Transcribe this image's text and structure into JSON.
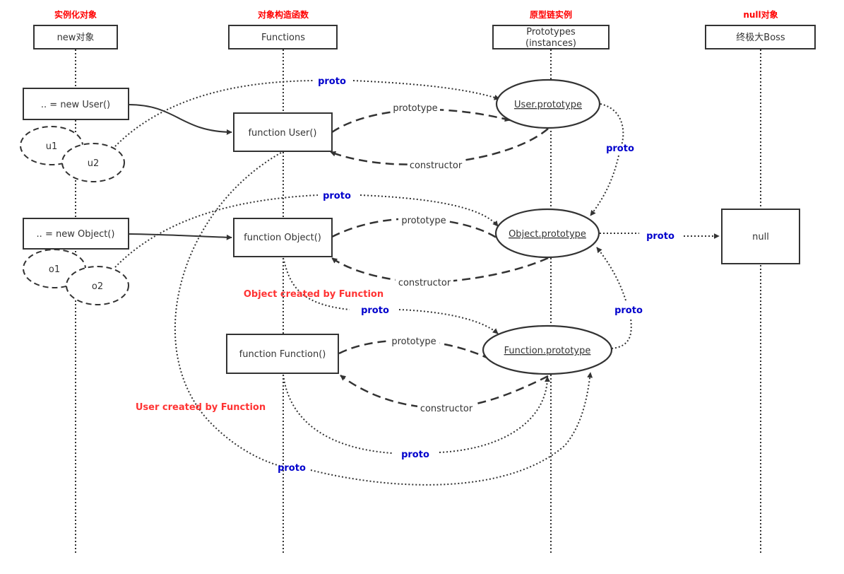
{
  "lanes": [
    {
      "id": "instances",
      "title": "实例化对象",
      "header": "new对象"
    },
    {
      "id": "functions",
      "title": "对象构造函数",
      "header": "Functions"
    },
    {
      "id": "prototypes",
      "title": "原型链实例",
      "header_line1": "Prototypes",
      "header_line2": "(instances)"
    },
    {
      "id": "null",
      "title": "null对象",
      "header": "终极大Boss"
    }
  ],
  "nodes": {
    "new_user": ".. = new User()",
    "new_object": ".. = new Object()",
    "u1": "u1",
    "u2": "u2",
    "o1": "o1",
    "o2": "o2",
    "function_user": "function User()",
    "function_object": "function Object()",
    "function_function": "function Function()",
    "user_prototype": "User.prototype",
    "object_prototype": "Object.prototype",
    "function_prototype": "Function.prototype",
    "null_box": "null"
  },
  "edges": {
    "prototype": "prototype",
    "constructor": "constructor",
    "proto": "proto"
  },
  "notes": {
    "object_created": "Object created by Function",
    "user_created": "User created by Function"
  },
  "colors": {
    "lane_title": "#ff0000",
    "proto_label": "#0000cc",
    "note": "#ff3333",
    "stroke": "#333333"
  }
}
